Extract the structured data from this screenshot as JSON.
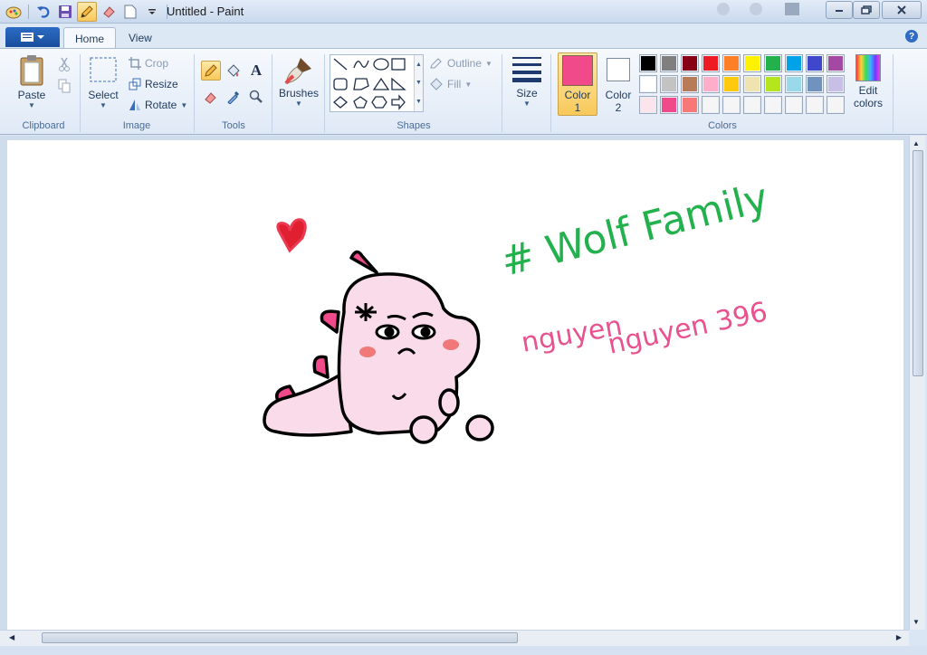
{
  "window": {
    "title": "Untitled - Paint"
  },
  "tabs": {
    "home": "Home",
    "view": "View"
  },
  "help": "?",
  "clipboard": {
    "paste": "Paste",
    "group": "Clipboard"
  },
  "image": {
    "select": "Select",
    "crop": "Crop",
    "resize": "Resize",
    "rotate": "Rotate",
    "group": "Image"
  },
  "tools": {
    "group": "Tools",
    "text_glyph": "A"
  },
  "brushes": {
    "label": "Brushes"
  },
  "shapes": {
    "outline": "Outline",
    "fill": "Fill",
    "group": "Shapes"
  },
  "size": {
    "label": "Size"
  },
  "colors": {
    "color1_label": "Color",
    "color1_num": "1",
    "color2_label": "Color",
    "color2_num": "2",
    "edit_label": "Edit",
    "edit_label2": "colors",
    "group": "Colors",
    "color1": "#f04a8a",
    "color2": "#ffffff",
    "palette": [
      "#000000",
      "#7f7f7f",
      "#880015",
      "#ed1c24",
      "#ff7f27",
      "#fff200",
      "#22b14c",
      "#00a2e8",
      "#3f48cc",
      "#a349a4",
      "#ffffff",
      "#c3c3c3",
      "#b97a57",
      "#ffaec9",
      "#ffc90e",
      "#efe4b0",
      "#b5e61d",
      "#99d9ea",
      "#7092be",
      "#c8bfe7",
      "#fce4ec",
      "#f04a8a",
      "#f87878",
      "#f5f5f5",
      "#f5f5f5",
      "#f5f5f5",
      "#f5f5f5",
      "#f5f5f5",
      "#f5f5f5",
      "#f5f5f5"
    ]
  },
  "drawing": {
    "green_text": "# Wolf Family",
    "pink_text_1": "nguyen",
    "pink_text_2": "nguyen 396",
    "green_color": "#22b14c",
    "pink_color": "#e8528e"
  }
}
